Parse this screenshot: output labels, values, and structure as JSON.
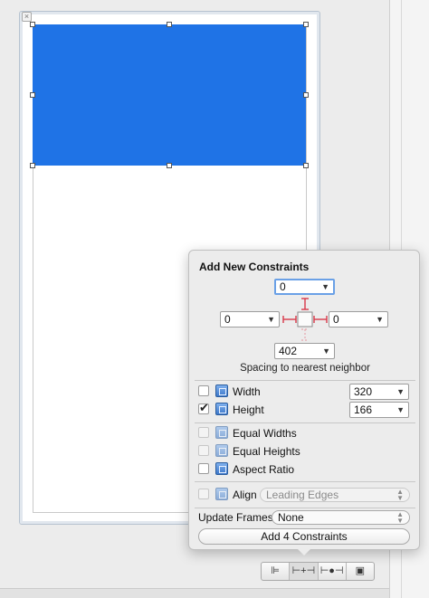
{
  "window": {
    "close_glyph": "×"
  },
  "popover": {
    "title": "Add New Constraints",
    "spacing": {
      "top": "0",
      "left": "0",
      "right": "0",
      "bottom": "402",
      "label": "Spacing to nearest neighbor"
    },
    "size_rows": [
      {
        "label": "Width",
        "checked": false,
        "value": "320"
      },
      {
        "label": "Height",
        "checked": true,
        "value": "166"
      }
    ],
    "equal_rows": [
      {
        "label": "Equal Widths",
        "enabled": false
      },
      {
        "label": "Equal Heights",
        "enabled": false
      },
      {
        "label": "Aspect Ratio",
        "enabled": true
      }
    ],
    "align": {
      "label": "Align",
      "value": "Leading Edges",
      "enabled": false
    },
    "update_frames": {
      "label": "Update Frames",
      "value": "None"
    },
    "add_button": "Add 4 Constraints"
  },
  "toolbar": {
    "buttons": [
      {
        "name": "align",
        "glyph": "⊫"
      },
      {
        "name": "pin",
        "glyph": "⊢+⊣"
      },
      {
        "name": "resolve",
        "glyph": "⊢●⊣"
      },
      {
        "name": "resizing",
        "glyph": "▣"
      }
    ]
  },
  "colors": {
    "selected_view": "#1f73e6",
    "constraint_strut": "#d9394a",
    "focus_ring": "#6aa0e6"
  }
}
